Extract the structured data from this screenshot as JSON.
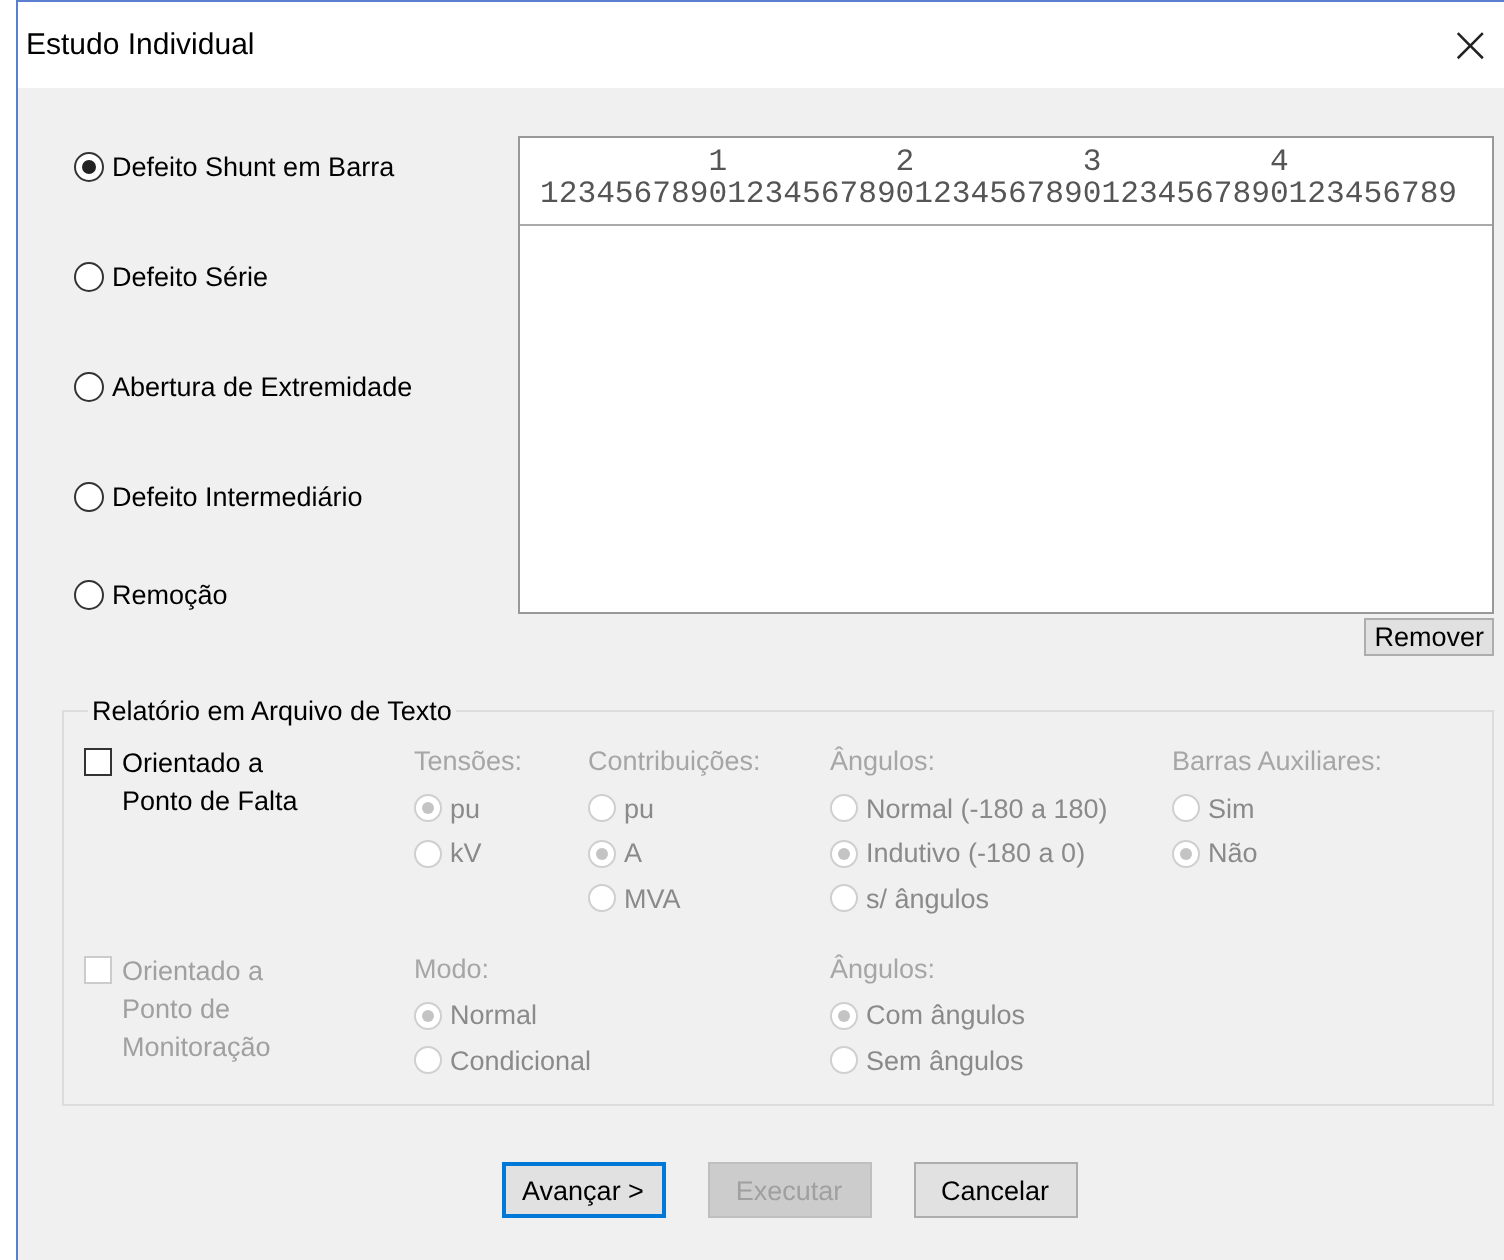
{
  "window": {
    "title": "Estudo Individual",
    "close": "×"
  },
  "fault_types": [
    {
      "label": "Defeito Shunt em Barra",
      "selected": true
    },
    {
      "label": "Defeito Série",
      "selected": false
    },
    {
      "label": "Abertura de Extremidade",
      "selected": false
    },
    {
      "label": "Defeito Intermediário",
      "selected": false
    },
    {
      "label": "Remoção",
      "selected": false
    }
  ],
  "text_area": {
    "ruler": [
      "         1         2         3         4",
      "1234567890123456789012345678901234567890123456789"
    ]
  },
  "remove_button": {
    "label": "Remover"
  },
  "report_group": {
    "title": "Relatório em Arquivo de Texto",
    "sections": [
      {
        "checkbox": {
          "label": "Orientado a Ponto de Falta",
          "checked": false,
          "disabled": false
        },
        "option_groups": [
          {
            "title": "Tensões:",
            "disabled": true,
            "options": [
              {
                "label": "pu",
                "selected": true
              },
              {
                "label": "kV",
                "selected": false
              }
            ]
          },
          {
            "title": "Contribuições:",
            "disabled": true,
            "options": [
              {
                "label": "pu",
                "selected": false
              },
              {
                "label": "A",
                "selected": true
              },
              {
                "label": "MVA",
                "selected": false
              }
            ]
          },
          {
            "title": "Ângulos:",
            "disabled": true,
            "options": [
              {
                "label": "Normal (-180 a 180)",
                "selected": false
              },
              {
                "label": "Indutivo (-180 a 0)",
                "selected": true
              },
              {
                "label": "s/ ângulos",
                "selected": false
              }
            ]
          },
          {
            "title": "Barras Auxiliares:",
            "disabled": true,
            "options": [
              {
                "label": "Sim",
                "selected": false
              },
              {
                "label": "Não",
                "selected": true
              }
            ]
          }
        ]
      },
      {
        "checkbox": {
          "label": "Orientado a Ponto de Monitoração",
          "checked": false,
          "disabled": true
        },
        "option_groups": [
          {
            "title": "Modo:",
            "disabled": true,
            "options": [
              {
                "label": "Normal",
                "selected": true
              },
              {
                "label": "Condicional",
                "selected": false
              }
            ]
          },
          {
            "title": "Ângulos:",
            "disabled": true,
            "options": [
              {
                "label": "Com ângulos",
                "selected": true
              },
              {
                "label": "Sem ângulos",
                "selected": false
              }
            ]
          }
        ]
      }
    ]
  },
  "buttons": [
    {
      "label": "Avançar >",
      "focused": true,
      "disabled": false
    },
    {
      "label": "Executar",
      "focused": false,
      "disabled": true
    },
    {
      "label": "Cancelar",
      "focused": false,
      "disabled": false
    }
  ]
}
